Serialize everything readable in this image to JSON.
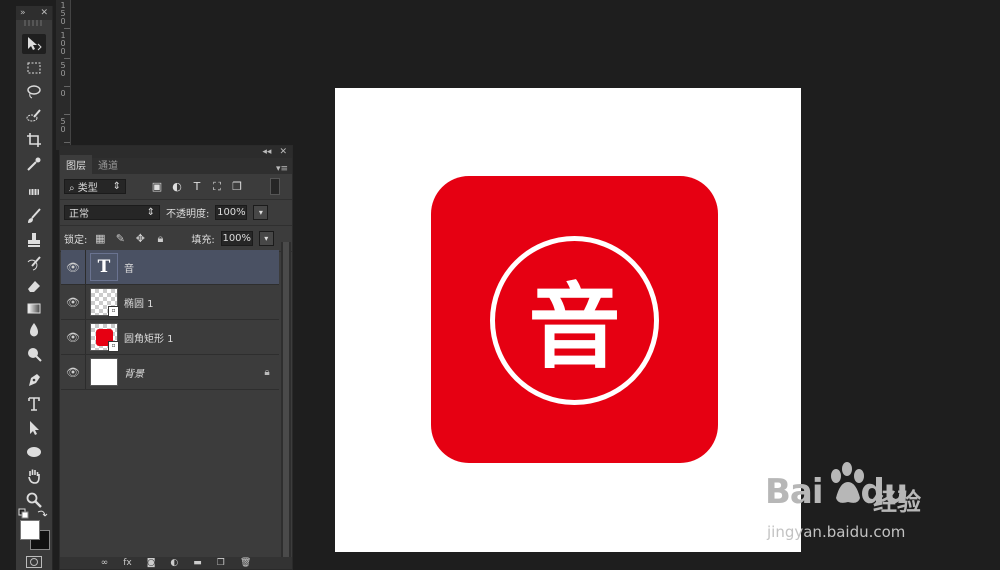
{
  "toolbar": {
    "collapse_label": "»",
    "close_label": "✕",
    "tools": [
      "move-tool",
      "marquee-tool",
      "lasso-tool",
      "quick-select-tool",
      "crop-tool",
      "eyedropper-tool",
      "spot-heal-tool",
      "brush-tool",
      "stamp-tool",
      "history-brush-tool",
      "eraser-tool",
      "gradient-tool",
      "blur-tool",
      "dodge-tool",
      "pen-tool",
      "type-tool",
      "path-select-tool",
      "ellipse-tool",
      "hand-tool",
      "zoom-tool"
    ]
  },
  "ruler": {
    "labels": [
      "1",
      "5",
      "0",
      "1",
      "0",
      "0",
      "5",
      "0",
      "0",
      "5",
      "0"
    ]
  },
  "panel": {
    "tabs": [
      {
        "label": "图层",
        "active": true
      },
      {
        "label": "通道",
        "active": false
      }
    ],
    "filter": {
      "label": "类型"
    },
    "blend": {
      "label": "正常"
    },
    "opacity": {
      "label": "不透明度:",
      "value": "100%"
    },
    "lock": {
      "label": "锁定:"
    },
    "fill": {
      "label": "填充:",
      "value": "100%"
    },
    "layers": [
      {
        "name": "音",
        "type": "text",
        "selected": true
      },
      {
        "name": "椭圆 1",
        "type": "shape-ellipse",
        "selected": false
      },
      {
        "name": "圆角矩形 1",
        "type": "shape-rect",
        "selected": false
      },
      {
        "name": "背景",
        "type": "background",
        "selected": false,
        "locked": true
      }
    ]
  },
  "canvas": {
    "glyph": "音",
    "colors": {
      "icon": "#e60012",
      "canvas": "#ffffff",
      "ring": "#ffffff"
    }
  },
  "watermark": {
    "logo": "Bai",
    "logo_suffix": "du",
    "cn": "经验",
    "url": "jingyan.baidu.com"
  }
}
